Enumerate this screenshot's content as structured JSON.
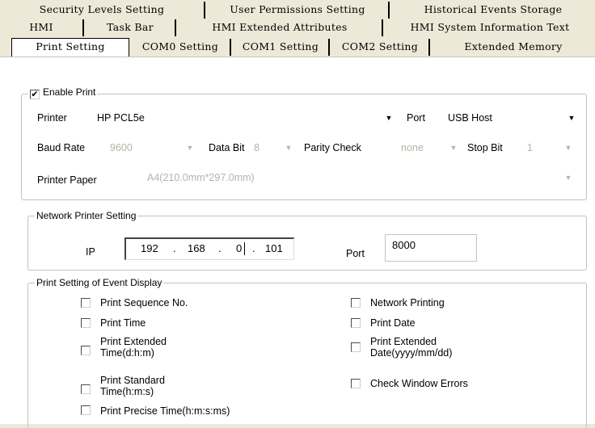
{
  "tabs": {
    "row1": [
      "Security Levels Setting",
      "User Permissions Setting",
      "Historical Events Storage"
    ],
    "row2": [
      "HMI",
      "Task Bar",
      "HMI Extended Attributes",
      "HMI System Information Text"
    ],
    "row3": [
      "Print Setting",
      "COM0 Setting",
      "COM1 Setting",
      "COM2 Setting",
      "Extended Memory"
    ],
    "active": "Print Setting"
  },
  "enable_print": {
    "label": "Enable Print",
    "checked": true,
    "mark": "✔"
  },
  "printer": {
    "printer_label": "Printer",
    "printer_value": "HP PCL5e",
    "port_label": "Port",
    "port_value": "USB Host",
    "baud_label": "Baud Rate",
    "baud_value": "9600",
    "databit_label": "Data Bit",
    "databit_value": "8",
    "parity_label": "Parity Check",
    "parity_value": "none",
    "stopbit_label": "Stop Bit",
    "stopbit_value": "1",
    "paper_label": "Printer Paper",
    "paper_value": "A4(210.0mm*297.0mm)"
  },
  "network": {
    "title": "Network Printer Setting",
    "ip_label": "IP",
    "ip": [
      "192",
      "168",
      "0",
      "101"
    ],
    "dot": ".",
    "port_label": "Port",
    "port_value": "8000"
  },
  "event_display": {
    "title": "Print Setting of Event Display",
    "left": [
      "Print Sequence No.",
      "Print Time",
      "Print Extended\nTime(d:h:m)",
      "Print Standard\nTime(h:m:s)",
      "Print Precise Time(h:m:s:ms)"
    ],
    "right": [
      "Network Printing",
      "Print Date",
      "Print Extended\nDate(yyyy/mm/dd)",
      "Check Window Errors"
    ]
  },
  "icons": {
    "dropdown": "▼"
  }
}
